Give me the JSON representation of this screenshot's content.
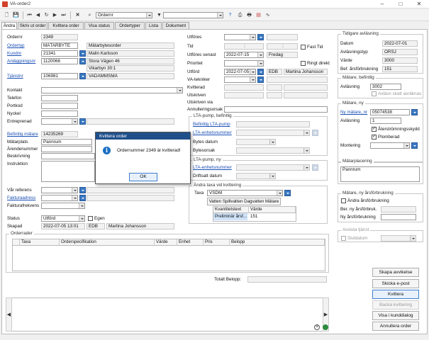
{
  "window": {
    "title": "VA-order2"
  },
  "toolbar": {
    "order_select": "Ordernr"
  },
  "tabs": [
    {
      "label": "Ändra"
    },
    {
      "label": "Skriv ut order"
    },
    {
      "label": "Kvittera order"
    },
    {
      "label": "Visa status"
    },
    {
      "label": "Ordertyper"
    },
    {
      "label": "Lista"
    },
    {
      "label": "Dokument"
    }
  ],
  "left": {
    "ordernr_label": "Ordernr",
    "ordernr": "2349",
    "ordertyp_label": "Ordertyp",
    "ordertyp_code": "MÄTARBYTE",
    "ordertyp_name": "Mätarbytesorder",
    "kundnr_label": "Kundnr",
    "kundnr": "21341",
    "kund_name": "Malin Karlsson",
    "anl_label": "Anläggningsnr",
    "anl_nr": "1120066",
    "address": "Stora Vägen 46",
    "area": "Vikarbyn 30:1",
    "tjanstnr_label": "Tjänstnr",
    "tjanstnr": "106981",
    "tjanst_name": "VADÄMMSMÄ",
    "kontakt_label": "Kontakt",
    "telefon_label": "Telefon",
    "portkod_label": "Portkod",
    "nyckel_label": "Nyckel",
    "entreprenad_label": "Entreprenad",
    "befintlig_label": "Befintlig mätare",
    "befintlig_value": "14235269",
    "matarplats_label": "Mätarplats",
    "matarplats_value": "Pannrum",
    "arende_label": "Ärendenummer",
    "beskrivning_label": "Beskrivning",
    "instruktion_label": "Instruktion",
    "var_ref_label": "Vår referens",
    "faktura_label": "Fakturaadress",
    "frekvens_label": "Fakturafrekvens",
    "status_label": "Status",
    "status_value": "Utförd",
    "egen_label": "Egen",
    "skapad_label": "Skapad",
    "skapad_date": "2022-07-05 13:01",
    "skapad_by": "EDB",
    "skapad_name": "Martina Johansson"
  },
  "middle": {
    "utfores_label": "Utföres",
    "tid_label": "Tid",
    "tid_from": ":",
    "tid_to": ":",
    "fast_tid_label": "Fast Tid",
    "senast_label": "Utföres senast",
    "senast_date": "2022-07-15",
    "senast_day": "Fredag",
    "prioritet_label": "Prioritet",
    "ringt_label": "Ringt direkt",
    "utford_label": "Utförd",
    "utford_date": "2022-07-05",
    "utford_by": "EDB",
    "utford_name": "Martina Johansson",
    "vatekniker_label": "VA-tekniker",
    "kvitterad_label": "Kvitterad",
    "utskriven_label": "Utskriven",
    "utskriven_via_label": "Utskriven via",
    "annullering_label": "Annulleringsorsak",
    "lta_bef_title": "LTA-pump, befintlig",
    "lta_bef_label": "Befintlig LTA-pump",
    "lta_enhet_label": "LTA-enhetsnummer",
    "bytes_label": "Bytes datum",
    "bytesorsak_label": "Bytesorsak",
    "lta_ny_title": "LTA-pump, ny",
    "lta_ny_enhet_label": "LTA-enhetsnummer",
    "drift_label": "Driftsatt datum",
    "taxa_title": "Ändra taxa vid kvittering",
    "taxa_label": "Taxa",
    "taxa_value": "VSDM",
    "taxa_desc": "Vatten Spillvatten Dagvatten Mätare",
    "tbl_col1": "Kvantitetstext",
    "tbl_col2": "Värde",
    "tbl_row_text": "Preliminär årsf...",
    "tbl_row_value": "151"
  },
  "right": {
    "avl_title": "Tidigare avläsning",
    "datum_label": "Datum",
    "datum_value": "2022-07-01",
    "avltyp_label": "Avläsningstyp",
    "avltyp_value": "ORSJ",
    "varde_label": "Värde",
    "varde_value": "3000",
    "bef_ars_label": "Bef. årsförbrukning",
    "bef_ars_value": "151",
    "mb_title": "Mätare, befintlig",
    "mb_avl_label": "Avläsning",
    "mb_avl_value": "3002",
    "mb_skatt_label": "Avläsn skatt avräknas",
    "mn_title": "Mätare, ny",
    "mn_nr_label": "Ny mätare, nr",
    "mn_nr_value": "05074538",
    "mn_avl_label": "Avläsning",
    "mn_avl_value": "1",
    "aterstromning_label": "Återströmningsskydd",
    "plomberad_label": "Plomberad",
    "montering_label": "Montering",
    "placering_title": "Mätarplacering",
    "placering_value": "Pannrum",
    "ny_ars_title": "Mätare, ny årsförbrukning",
    "andra_label": "Ändra årsförbrukning",
    "ber_label": "Ber. ny årsförbruk.",
    "ny_ars_label": "Ny årsförbrukning",
    "avsluta_title": "Avsluta tjänst",
    "slutdatum_label": "Slutdatum"
  },
  "orderrader": {
    "title": "Orderrader",
    "columns": [
      "Taxa",
      "Orderspecifikation",
      "Värde",
      "Enhet",
      "Pris",
      "Belopp"
    ],
    "total_label": "Totalt Belopp:"
  },
  "buttons": {
    "avvikelse": "Skapa avvikelse",
    "epost": "Skicka e-post",
    "kvittera": "Kvittera",
    "backa": "Backa kvittering",
    "kunddialog": "Visa i kunddialog",
    "annullera": "Annullera order"
  },
  "modal": {
    "title": "Kvittera order",
    "message": "Ordernummer 2349 är kvitterad!",
    "ok": "OK"
  }
}
